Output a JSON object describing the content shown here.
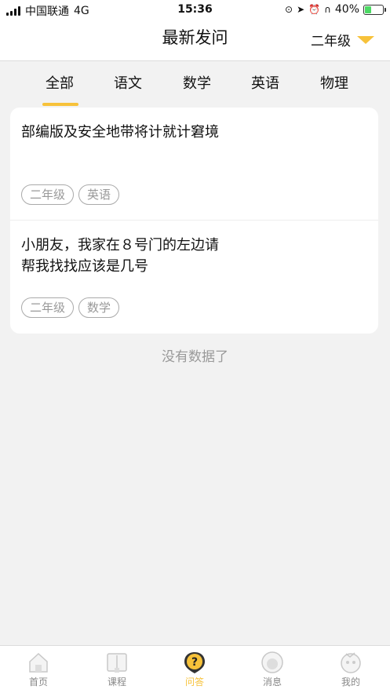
{
  "status_bar": {
    "carrier": "中国联通",
    "network": "4G",
    "time": "15:36",
    "battery": "40%",
    "battery_level": 0.4
  },
  "header": {
    "title": "最新发问",
    "grade": "二年级"
  },
  "tabs": [
    {
      "label": "全部",
      "active": true
    },
    {
      "label": "语文",
      "active": false
    },
    {
      "label": "数学",
      "active": false
    },
    {
      "label": "英语",
      "active": false
    },
    {
      "label": "物理",
      "active": false
    }
  ],
  "questions": [
    {
      "lines": [
        "部编版及安全地带将计就计窘境"
      ],
      "tags": [
        "二年级",
        "英语"
      ]
    },
    {
      "lines": [
        "小朋友，我家在８号门的左边请",
        "帮我找找应该是几号"
      ],
      "tags": [
        "二年级",
        "数学"
      ]
    }
  ],
  "list_end_text": "没有数据了",
  "bottom_nav": [
    {
      "label": "首页",
      "icon": "home-icon"
    },
    {
      "label": "课程",
      "icon": "book-icon"
    },
    {
      "label": "问答",
      "icon": "question-icon",
      "active": true
    },
    {
      "label": "消息",
      "icon": "message-icon"
    },
    {
      "label": "我的",
      "icon": "profile-icon"
    }
  ],
  "colors": {
    "accent": "#f7c23a",
    "background": "#f2f2f2",
    "tag_border": "#aaaaaa"
  }
}
